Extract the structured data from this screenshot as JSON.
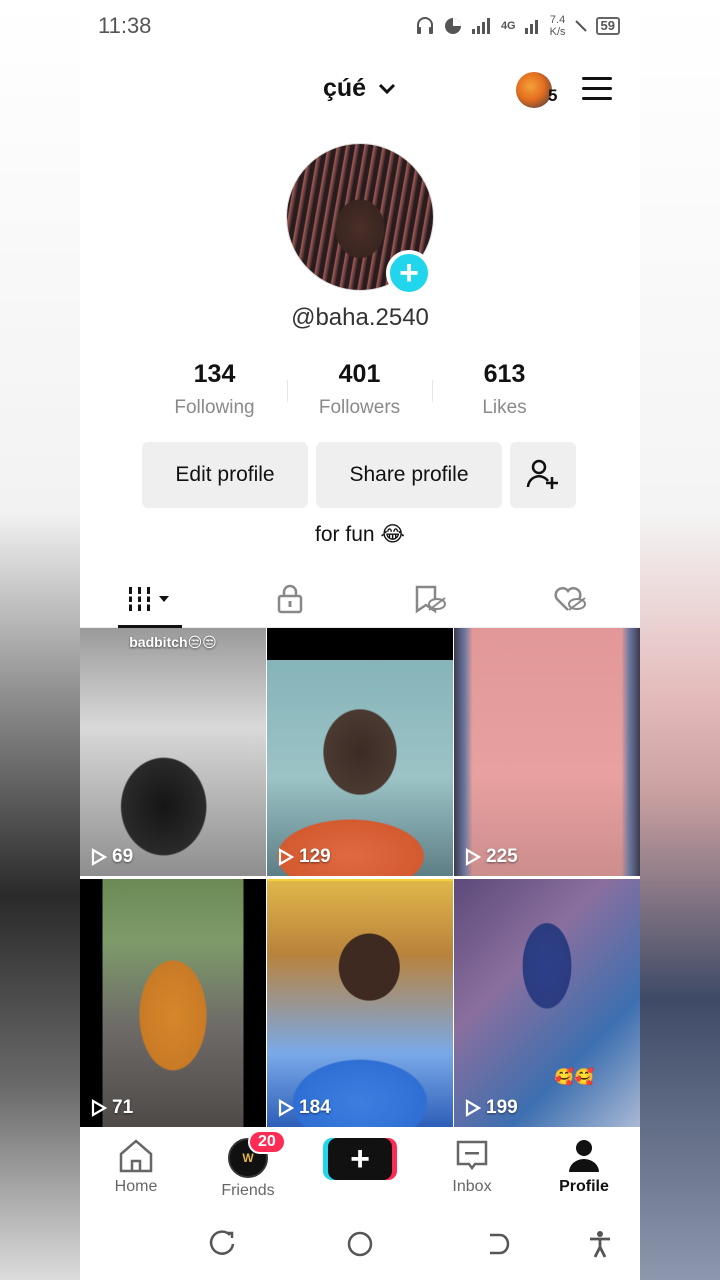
{
  "status_bar": {
    "time": "11:38",
    "network": "4G",
    "speed_value": "7.4",
    "speed_unit": "K/s",
    "battery": "59"
  },
  "header": {
    "username": "çúé",
    "notification_count": "5"
  },
  "profile": {
    "handle": "@baha.2540",
    "stats": [
      {
        "value": "134",
        "label": "Following"
      },
      {
        "value": "401",
        "label": "Followers"
      },
      {
        "value": "613",
        "label": "Likes"
      }
    ],
    "buttons": {
      "edit": "Edit profile",
      "share": "Share profile"
    },
    "bio": "for fun 😂"
  },
  "tabs": [
    {
      "icon": "grid-icon",
      "active": true
    },
    {
      "icon": "lock-icon",
      "active": false
    },
    {
      "icon": "hidden-bookmark-icon",
      "active": false
    },
    {
      "icon": "hidden-heart-icon",
      "active": false
    }
  ],
  "videos": [
    {
      "views": "69",
      "caption": "badbitch😒😒"
    },
    {
      "views": "129"
    },
    {
      "views": "225"
    },
    {
      "views": "71"
    },
    {
      "views": "184"
    },
    {
      "views": "199",
      "sticker": "🥰🥰"
    }
  ],
  "bottom_nav": {
    "home": "Home",
    "friends": "Friends",
    "friends_badge": "20",
    "inbox": "Inbox",
    "profile": "Profile"
  },
  "colors": {
    "accent_cyan": "#20d5ec",
    "accent_pink": "#fe2c55"
  }
}
